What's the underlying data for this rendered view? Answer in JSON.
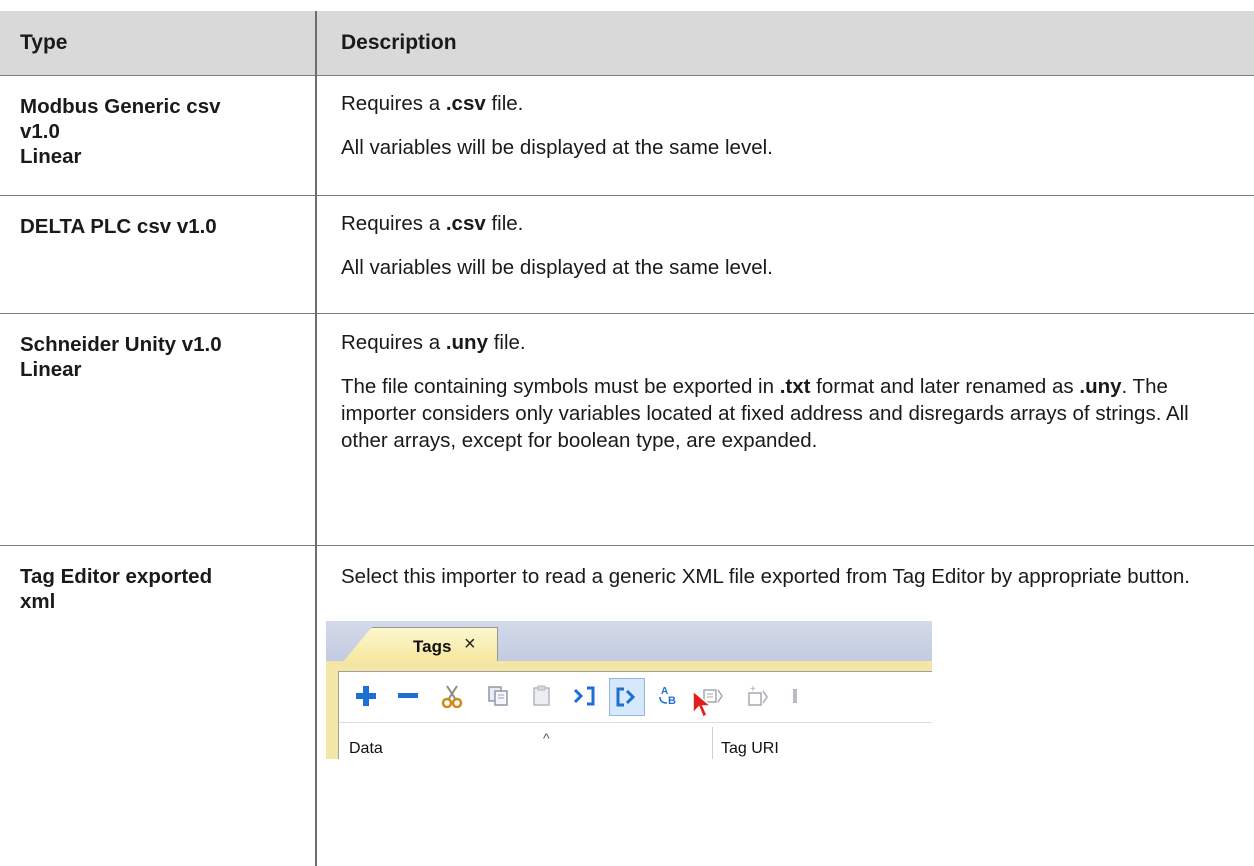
{
  "table": {
    "header": {
      "type": "Type",
      "description": "Description"
    },
    "rows": [
      {
        "type_lines": [
          "Modbus Generic csv",
          "v1.0",
          "Linear"
        ],
        "p1": {
          "pre": "Requires a ",
          "bold": ".csv",
          "post": " file."
        },
        "p2": "All variables will be displayed at the same level."
      },
      {
        "type_lines": [
          "DELTA PLC csv v1.0"
        ],
        "p1": {
          "pre": "Requires a ",
          "bold": ".csv",
          "post": " file."
        },
        "p2": "All variables will be displayed at the same level."
      },
      {
        "type_lines": [
          "Schneider Unity v1.0",
          "Linear"
        ],
        "p1": {
          "pre": "Requires a ",
          "bold": ".uny",
          "post": " file."
        },
        "p2": {
          "t1": "The file containing symbols must be exported in ",
          "b1": ".txt",
          "t2": " format and later renamed as ",
          "b2": ".uny",
          "t3": ". The importer considers only variables located at fixed address and disregards arrays of strings. All other arrays, except for boolean type, are expanded."
        }
      },
      {
        "type_lines": [
          "Tag Editor exported",
          "xml"
        ],
        "p1": "Select this importer to read a generic XML file exported from Tag Editor by appropriate button."
      }
    ]
  },
  "screenshot": {
    "tab_label": "Tags",
    "tab_close": "×",
    "toolbar_icons": [
      "add-icon",
      "remove-icon",
      "cut-icon",
      "copy-icon",
      "paste-icon",
      "import-icon",
      "export-icon",
      "rename-icon",
      "tag-icon",
      "tag-add-icon",
      "more-icon"
    ],
    "column_data": "Data",
    "column_sort_glyph": "^",
    "column_tag_uri": "Tag URI",
    "colors": {
      "tab_fill": "#f5e79b",
      "frame": "#f4e6a6",
      "accent_blue": "#1d6fd1",
      "highlight": "#d7e8fb"
    }
  }
}
